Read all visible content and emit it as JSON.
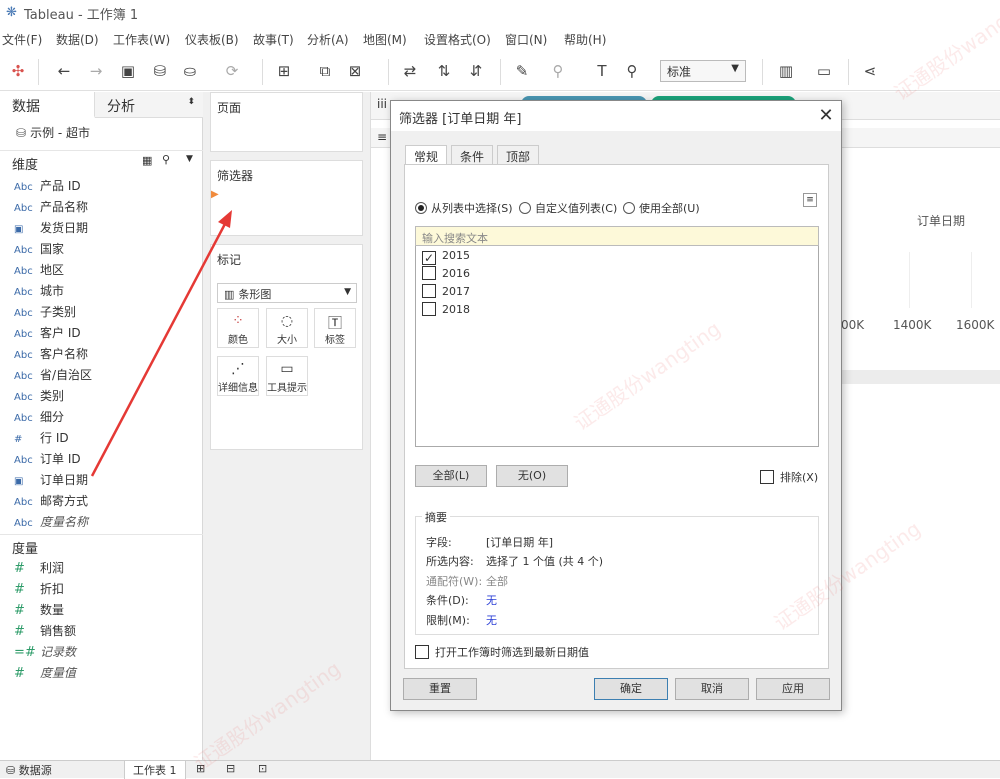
{
  "window": {
    "title": "Tableau - 工作簿 1"
  },
  "menu": [
    "文件(F)",
    "数据(D)",
    "工作表(W)",
    "仪表板(B)",
    "故事(T)",
    "分析(A)",
    "地图(M)",
    "设置格式(O)",
    "窗口(N)",
    "帮助(H)"
  ],
  "toolbar": {
    "view_select": "标准"
  },
  "left_pane": {
    "tab_data": "数据",
    "tab_analysis": "分析",
    "datasource": "示例 - 超市",
    "dimensions_header": "维度",
    "measures_header": "度量",
    "dimensions": [
      {
        "type": "Abc",
        "label": "产品 ID"
      },
      {
        "type": "Abc",
        "label": "产品名称"
      },
      {
        "type": "date",
        "label": "发货日期"
      },
      {
        "type": "Abc",
        "label": "国家"
      },
      {
        "type": "Abc",
        "label": "地区"
      },
      {
        "type": "Abc",
        "label": "城市"
      },
      {
        "type": "Abc",
        "label": "子类别"
      },
      {
        "type": "Abc",
        "label": "客户 ID"
      },
      {
        "type": "Abc",
        "label": "客户名称"
      },
      {
        "type": "Abc",
        "label": "省/自治区"
      },
      {
        "type": "Abc",
        "label": "类别"
      },
      {
        "type": "Abc",
        "label": "细分"
      },
      {
        "type": "#",
        "label": "行 ID"
      },
      {
        "type": "Abc",
        "label": "订单 ID"
      },
      {
        "type": "date",
        "label": "订单日期"
      },
      {
        "type": "Abc",
        "label": "邮寄方式"
      },
      {
        "type": "Abc",
        "label": "度量名称"
      }
    ],
    "measures": [
      {
        "type": "#",
        "label": "利润"
      },
      {
        "type": "#",
        "label": "折扣"
      },
      {
        "type": "#",
        "label": "数量"
      },
      {
        "type": "#",
        "label": "销售额"
      },
      {
        "type": "=#",
        "label": "记录数"
      },
      {
        "type": "#",
        "label": "度量值"
      }
    ]
  },
  "shelves": {
    "pages": "页面",
    "filters": "筛选器",
    "marks": "标记",
    "mark_type": "条形图",
    "mark_buttons": [
      "颜色",
      "大小",
      "标签",
      "详细信息",
      "工具提示"
    ]
  },
  "canvas": {
    "axis_title": "订单日期",
    "ticks": [
      "00K",
      "1400K",
      "1600K"
    ]
  },
  "dialog": {
    "title": "筛选器 [订单日期 年]",
    "tabs": [
      "常规",
      "条件",
      "顶部"
    ],
    "radio_list": "从列表中选择(S)",
    "radio_custom": "自定义值列表(C)",
    "radio_all": "使用全部(U)",
    "search_placeholder": "输入搜索文本",
    "items": [
      {
        "label": "2015",
        "checked": true
      },
      {
        "label": "2016",
        "checked": false
      },
      {
        "label": "2017",
        "checked": false
      },
      {
        "label": "2018",
        "checked": false
      }
    ],
    "btn_all": "全部(L)",
    "btn_none": "无(O)",
    "exclude": "排除(X)",
    "summary": {
      "title": "摘要",
      "field_k": "字段:",
      "field_v": "[订单日期 年]",
      "sel_k": "所选内容:",
      "sel_v": "选择了 1 个值 (共 4 个)",
      "wild_k": "通配符(W):",
      "wild_v": "全部",
      "cond_k": "条件(D):",
      "cond_v": "无",
      "limit_k": "限制(M):",
      "limit_v": "无"
    },
    "open_latest": "打开工作簿时筛选到最新日期值",
    "btn_reset": "重置",
    "btn_ok": "确定",
    "btn_cancel": "取消",
    "btn_apply": "应用"
  },
  "bottom": {
    "tab_datasource": "数据源",
    "tab_sheet": "工作表 1"
  },
  "watermark": "证通股份wangting",
  "colors": {
    "arrow": "#e53935",
    "checked": "#222222",
    "pill_blue": "#4996b2",
    "pill_green": "#1ba37b"
  }
}
